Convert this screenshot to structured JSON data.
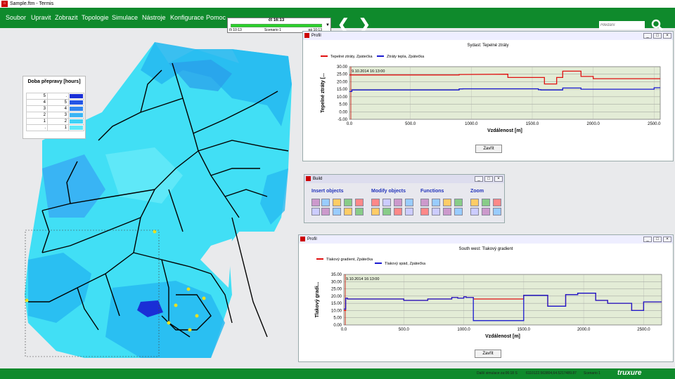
{
  "app": {
    "title": "Sample.ftm - Termis"
  },
  "menu": [
    "Soubor",
    "Upravit",
    "Zobrazit",
    "Topologie",
    "Simulace",
    "Nástroje",
    "Konfigurace",
    "Pomoc"
  ],
  "scenario": {
    "time": "čt 16:13",
    "start": "čt 10:13",
    "name": "Scenario 1",
    "end": "pá 10:13",
    "progress": 1.0
  },
  "search": {
    "placeholder": "Hledání"
  },
  "legend": {
    "title": "Doba přepravy [hours]",
    "rows": [
      {
        "from": "5",
        "to": ".",
        "color": "#1a2fd6"
      },
      {
        "from": "4",
        "to": "5",
        "color": "#2456e6"
      },
      {
        "from": "3",
        "to": "4",
        "color": "#2f86ef"
      },
      {
        "from": "2",
        "to": "3",
        "color": "#39b4f4"
      },
      {
        "from": "1",
        "to": "2",
        "color": "#3fd2f7"
      },
      {
        "from": ".",
        "to": "1",
        "color": "#5fe8f8"
      }
    ]
  },
  "profile1": {
    "window_title": "Profil",
    "subtitle": "Sydast: Tepelné ztráty",
    "close": "Zavřít",
    "timestamp": "9.10.2014 16:13:00"
  },
  "profile2": {
    "window_title": "Profil",
    "subtitle": "South west: Tlakový gradient",
    "close": "Zavřít",
    "timestamp": "9.10.2014 16:13:00"
  },
  "build": {
    "title": "Build",
    "groups": [
      "Insert objects",
      "Modify objects",
      "Functions",
      "Zoom"
    ]
  },
  "status": {
    "next_sim": "Další simulace za:06:18 S",
    "coords": "6110122.563804,64.5217489.87",
    "scenario": "Scenario 1",
    "logo": "truxure"
  },
  "chart_data": [
    {
      "type": "line",
      "xlabel": "Vzdálenost [m]",
      "ylabel": "Tepelné ztráty [...",
      "xlim": [
        0,
        2550
      ],
      "ylim": [
        -5,
        30
      ],
      "xticks": [
        "0.0",
        "500.0",
        "1000.0",
        "1500.0",
        "2000.0",
        "2500.0"
      ],
      "yticks": [
        "30.00",
        "25.00",
        "20.00",
        "15.00",
        "10.00",
        "5.00",
        "0.00",
        "-5.00"
      ],
      "series": [
        {
          "name": "Tepelné ztráty, Zpátečka",
          "color": "#e01010",
          "x": [
            0,
            900,
            900,
            930,
            1300,
            1300,
            1550,
            1600,
            1600,
            1700,
            1700,
            1750,
            1750,
            1900,
            1900,
            2000,
            2000,
            2550
          ],
          "y": [
            24.5,
            24.5,
            24.8,
            24.8,
            25,
            22.8,
            22.8,
            22.8,
            18.5,
            18.5,
            22.8,
            22.8,
            27,
            27,
            23.5,
            23.5,
            22,
            22
          ]
        },
        {
          "name": "Ztráty tepla, Zpátečka",
          "color": "#1a1ad0",
          "x": [
            0,
            20,
            20,
            900,
            900,
            930,
            930,
            1550,
            1550,
            1570,
            1570,
            1750,
            1750,
            1900,
            1900,
            2500,
            2500,
            2550
          ],
          "y": [
            13.5,
            13.5,
            14.5,
            14.5,
            15.2,
            15.2,
            15.3,
            15.3,
            14.7,
            14.7,
            14.5,
            14.5,
            15.8,
            15.8,
            15,
            15,
            16,
            16
          ]
        }
      ]
    },
    {
      "type": "line",
      "xlabel": "Vzdálenost [m]",
      "ylabel": "Tlakový gradi...",
      "xlim": [
        0,
        2650
      ],
      "ylim": [
        0,
        35
      ],
      "xticks": [
        "0.0",
        "500.0",
        "1000.0",
        "1500.0",
        "2000.0",
        "2500.0"
      ],
      "yticks": [
        "35.00",
        "30.00",
        "25.00",
        "20.00",
        "15.00",
        "10.00",
        "5.00",
        "0.00"
      ],
      "series": [
        {
          "name": "Tlakový gradient, Zpátečka",
          "color": "#e01010",
          "x": [
            0,
            15,
            15,
            30,
            30,
            500,
            500,
            700,
            700,
            900,
            900,
            950,
            950,
            1000,
            1000,
            1020,
            1020,
            1080,
            1080,
            1500,
            1500,
            1700,
            1700,
            1850,
            1850,
            1950,
            1950,
            2100,
            2100,
            2200,
            2200,
            2400,
            2400,
            2500,
            2500,
            2650
          ],
          "y": [
            10,
            10,
            18.5,
            18.5,
            18,
            18,
            17,
            17,
            18,
            18,
            19,
            19,
            18.5,
            18.5,
            19.5,
            19.5,
            19,
            19,
            18,
            18,
            20.5,
            20.5,
            13,
            13,
            21,
            21,
            22,
            22,
            17,
            17,
            15,
            15,
            10,
            10,
            16,
            16
          ]
        },
        {
          "name": "Tlakový spád, Zpátečka",
          "color": "#1a1ad0",
          "x": [
            0,
            15,
            15,
            30,
            30,
            500,
            500,
            700,
            700,
            900,
            900,
            950,
            950,
            1000,
            1000,
            1020,
            1020,
            1080,
            1080,
            1500,
            1500,
            1700,
            1700,
            1850,
            1850,
            1950,
            1950,
            2100,
            2100,
            2200,
            2200,
            2400,
            2400,
            2500,
            2500,
            2650
          ],
          "y": [
            11,
            11,
            18.5,
            18.5,
            18,
            18,
            17,
            17,
            18,
            18,
            19,
            19,
            18.5,
            18.5,
            19.5,
            19.5,
            19,
            19,
            3,
            3,
            20.5,
            20.5,
            13,
            13,
            21,
            21,
            22,
            22,
            17,
            17,
            15,
            15,
            10,
            10,
            16,
            16
          ]
        }
      ]
    }
  ]
}
